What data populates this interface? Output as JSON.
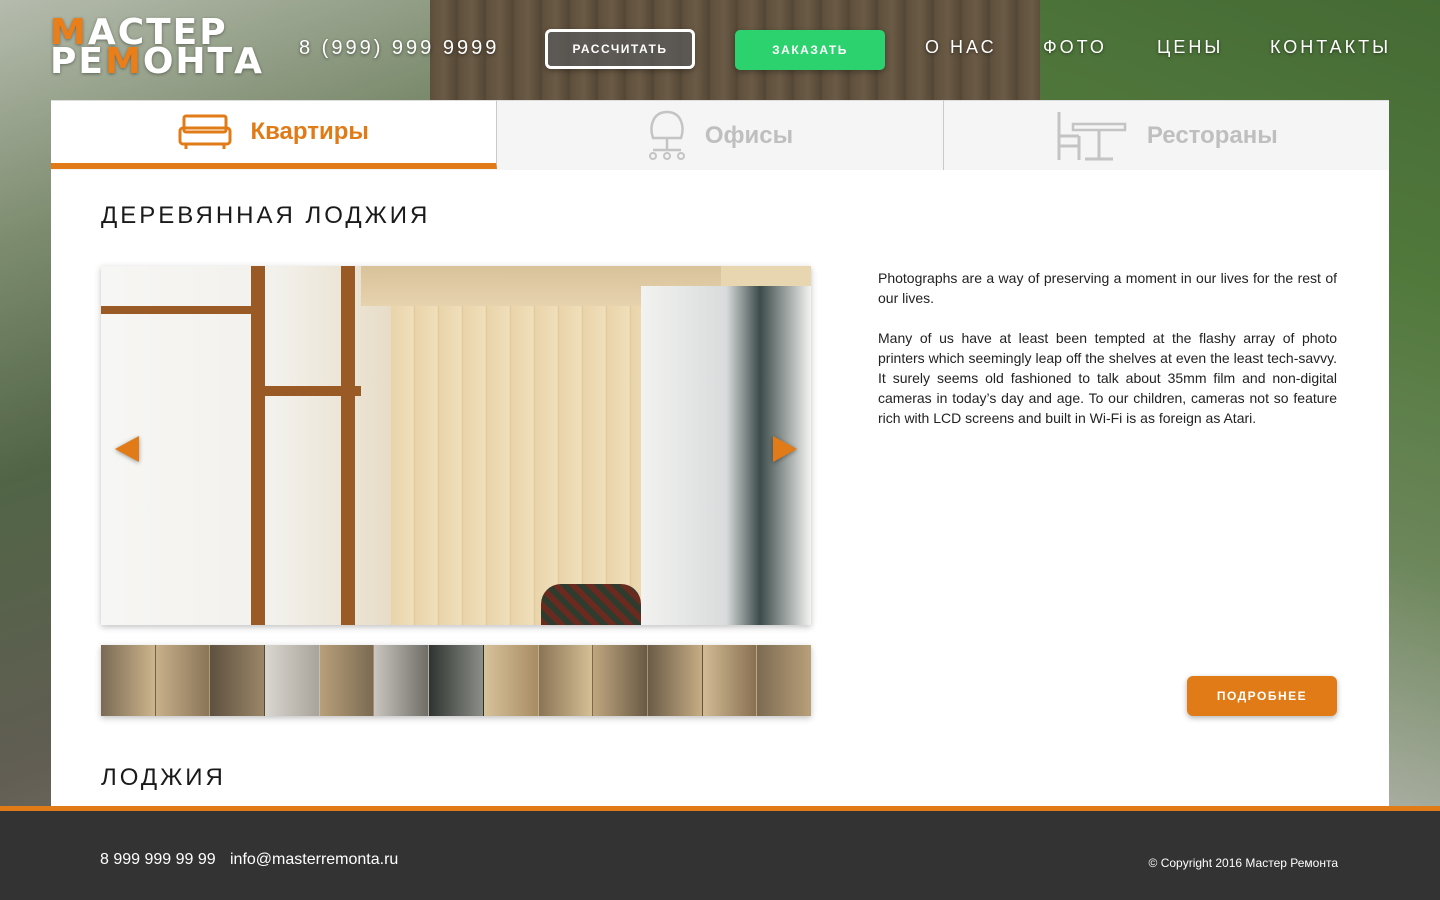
{
  "header": {
    "logo": {
      "line1_accent": "М",
      "line1_rest": "АСТЕР",
      "line2_pre": "РЕ",
      "line2_accent": "М",
      "line2_post": "ОНТА"
    },
    "phone": "8 (999) 999 9999",
    "calc_button": "РАССЧИТАТЬ",
    "order_button": "ЗАКАЗАТЬ",
    "nav": [
      "О НАС",
      "ФОТО",
      "ЦЕНЫ",
      "КОНТАКТЫ"
    ]
  },
  "tabs": [
    {
      "label": "Квартиры",
      "icon": "sofa-icon",
      "active": true
    },
    {
      "label": "Офисы",
      "icon": "chair-icon",
      "active": false
    },
    {
      "label": "Рестораны",
      "icon": "table-icon",
      "active": false
    }
  ],
  "colors": {
    "accent": "#e07b17",
    "order": "#2bd26e",
    "footer": "#333333"
  },
  "sections": [
    {
      "title": "ДЕРЕВЯННАЯ ЛОДЖИЯ",
      "paragraphs": [
        "Photographs are a way of preserving a moment in our lives for the rest of our lives.",
        "Many of us have at least been tempted at the flashy array of photo printers which seemingly leap off the shelves at even the least tech-savvy. It surely seems old fashioned to talk about 35mm film and non-digital cameras in today’s day and age. To our children, cameras not so feature rich with LCD screens and built in Wi-Fi is as foreign as Atari."
      ],
      "more_button": "ПОДРОБНЕЕ"
    },
    {
      "title": "ЛОДЖИЯ"
    }
  ],
  "footer": {
    "phone": "8 999 999 99 99",
    "email": "info@masterremonta.ru",
    "copyright": "© Copyright 2016 Мастер Ремонта"
  }
}
